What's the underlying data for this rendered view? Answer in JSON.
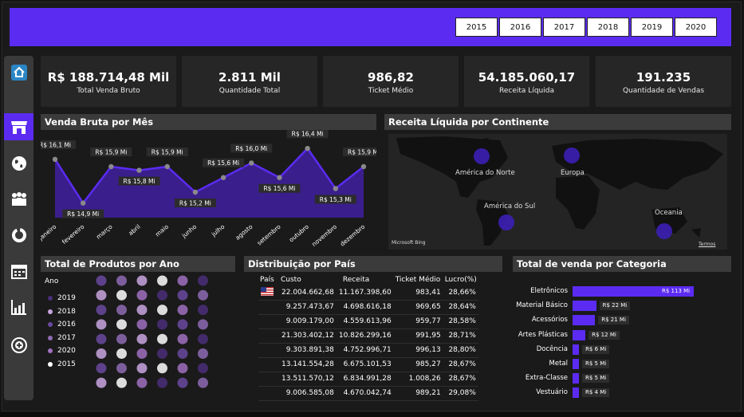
{
  "years": [
    "2015",
    "2016",
    "2017",
    "2018",
    "2019",
    "2020"
  ],
  "kpis": [
    {
      "value": "R$ 188.714,48 Mil",
      "label": "Total Venda Bruto"
    },
    {
      "value": "2.811 Mil",
      "label": "Quantidade Total"
    },
    {
      "value": "986,82",
      "label": "Ticket Médio"
    },
    {
      "value": "54.185.060,17",
      "label": "Receita Líquida"
    },
    {
      "value": "191.235",
      "label": "Quantidade de Vendas"
    }
  ],
  "sidebar": {
    "icons": [
      "home-icon",
      "store-icon",
      "globe-icon",
      "people-icon",
      "donut-chart-icon",
      "calendar-icon",
      "bar-chart-icon",
      "add-circle-icon"
    ]
  },
  "monthly": {
    "title": "Venda Bruta por Mês",
    "chart_data": {
      "type": "area",
      "categories": [
        "janeiro",
        "fevereiro",
        "março",
        "abril",
        "maio",
        "junho",
        "julho",
        "agosto",
        "setembro",
        "outubro",
        "novembro",
        "dezembro"
      ],
      "values": [
        16.1,
        14.9,
        15.9,
        15.8,
        15.9,
        15.2,
        15.6,
        16.0,
        15.6,
        16.4,
        15.3,
        15.9
      ],
      "data_labels": [
        "R$ 16,1 Mi",
        "R$ 14,9 Mi",
        "R$ 15,9 Mi",
        "R$ 15,8 Mi",
        "R$ 15,9 Mi",
        "R$ 15,2 Mi",
        "R$ 15,6 Mi",
        "R$ 16,0 Mi",
        "R$ 15,6 Mi",
        "R$ 16,4 Mi",
        "R$ 15,3 Mi",
        "R$ 15,9 Mi"
      ],
      "ylim": [
        14.5,
        16.6
      ],
      "color": "#5b2bf2"
    }
  },
  "map": {
    "title": "Receita Líquida por Continente",
    "labels": [
      "América do Norte",
      "Europa",
      "América do Sul",
      "Oceania"
    ],
    "attribution": "Microsoft Bing",
    "terms": "Termos"
  },
  "products": {
    "title": "Total de Produtos por Ano",
    "legend_title": "Ano",
    "legend": [
      {
        "label": "2019",
        "color": "#4b2f7a"
      },
      {
        "label": "2018",
        "color": "#c9a6e0"
      },
      {
        "label": "2016",
        "color": "#6a4aa0"
      },
      {
        "label": "2017",
        "color": "#8f6bb5"
      },
      {
        "label": "2020",
        "color": "#a070c0"
      },
      {
        "label": "2015",
        "color": "#ffffff"
      }
    ]
  },
  "countries": {
    "title": "Distribuição por País",
    "headers": [
      "País",
      "Custo",
      "Receita",
      "Ticket Médio",
      "Lucro(%)"
    ],
    "rows": [
      [
        "22.004.662,68",
        "11.167.398,60",
        "983,41",
        "28,66%"
      ],
      [
        "9.257.473,67",
        "4.698.616,18",
        "969,65",
        "28,64%"
      ],
      [
        "9.009.179,00",
        "4.559.613,96",
        "959,77",
        "28,58%"
      ],
      [
        "21.303.402,12",
        "10.826.299,16",
        "991,95",
        "28,71%"
      ],
      [
        "9.303.891,38",
        "4.752.996,71",
        "996,13",
        "28,80%"
      ],
      [
        "13.141.554,28",
        "6.675.101,53",
        "985,27",
        "28,67%"
      ],
      [
        "13.511.570,12",
        "6.834.991,28",
        "1.008,26",
        "28,67%"
      ],
      [
        "9.006.585,08",
        "4.670.042,74",
        "989,21",
        "29,08%"
      ]
    ]
  },
  "categories": {
    "title": "Total de venda por Categoria",
    "chart_data": {
      "type": "bar",
      "categories": [
        "Eletrônicos",
        "Material Básico",
        "Acessórios",
        "Artes Plásticas",
        "Docência",
        "Metal",
        "Extra-Classe",
        "Vestuário"
      ],
      "values": [
        113,
        22,
        21,
        12,
        6,
        5,
        5,
        4
      ],
      "data_labels": [
        "R$ 113 Mi",
        "R$ 22 Mi",
        "R$ 21 Mi",
        "R$ 12 Mi",
        "R$ 6 Mi",
        "R$ 5 Mi",
        "R$ 5 Mi",
        "R$ 4 Mi"
      ],
      "color": "#5b2bf2"
    }
  }
}
